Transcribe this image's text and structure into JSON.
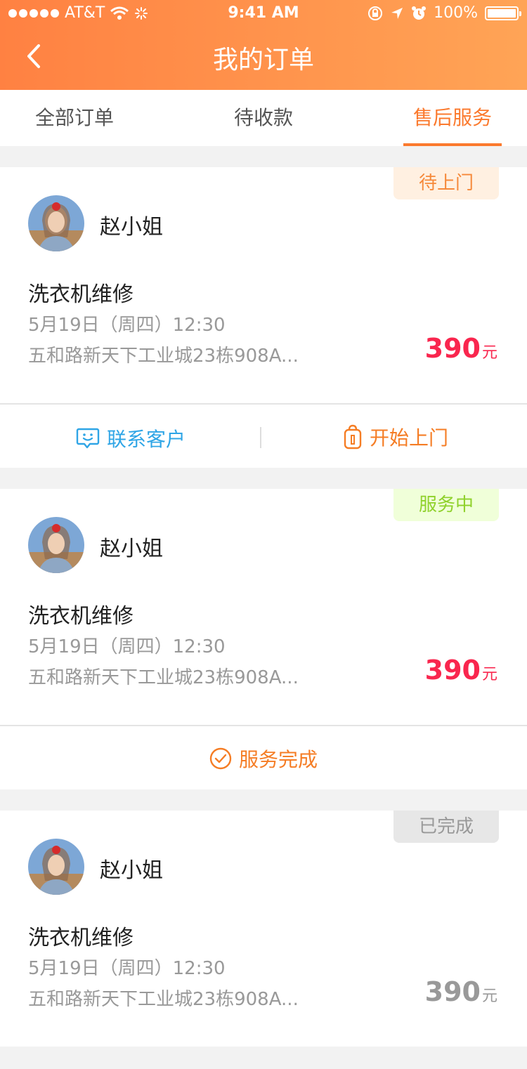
{
  "status_bar": {
    "carrier": "AT&T",
    "time": "9:41 AM",
    "battery": "100%",
    "battery_level": 1.0
  },
  "nav": {
    "title": "我的订单"
  },
  "tabs": [
    {
      "label": "全部订单",
      "active": false
    },
    {
      "label": "待收款",
      "active": false
    },
    {
      "label": "售后服务",
      "active": true
    }
  ],
  "orders": [
    {
      "status": "待上门",
      "customer": "赵小姐",
      "service": "洗衣机维修",
      "datetime": "5月19日（周四）12:30",
      "address": "五和路新天下工业城23栋908A...",
      "price": "390",
      "unit": "元",
      "actions": [
        "联系客户",
        "开始上门"
      ]
    },
    {
      "status": "服务中",
      "customer": "赵小姐",
      "service": "洗衣机维修",
      "datetime": "5月19日（周四）12:30",
      "address": "五和路新天下工业城23栋908A...",
      "price": "390",
      "unit": "元",
      "actions": [
        "服务完成"
      ]
    },
    {
      "status": "已完成",
      "customer": "赵小姐",
      "service": "洗衣机维修",
      "datetime": "5月19日（周四）12:30",
      "address": "五和路新天下工业城23栋908A...",
      "price": "390",
      "unit": "元",
      "actions": []
    }
  ],
  "colors": {
    "accent": "#fb7a2e",
    "price_red": "#f9264e",
    "contact_blue": "#2fa5e6",
    "badge_pending": "#fff0e1",
    "badge_in_service": "#f0ffd9",
    "badge_done": "#e7e7e7"
  },
  "icons": {
    "back": "chevron-left-icon",
    "contact": "chat-face-icon",
    "start_visit": "location-pin-icon",
    "complete": "check-circle-icon"
  }
}
